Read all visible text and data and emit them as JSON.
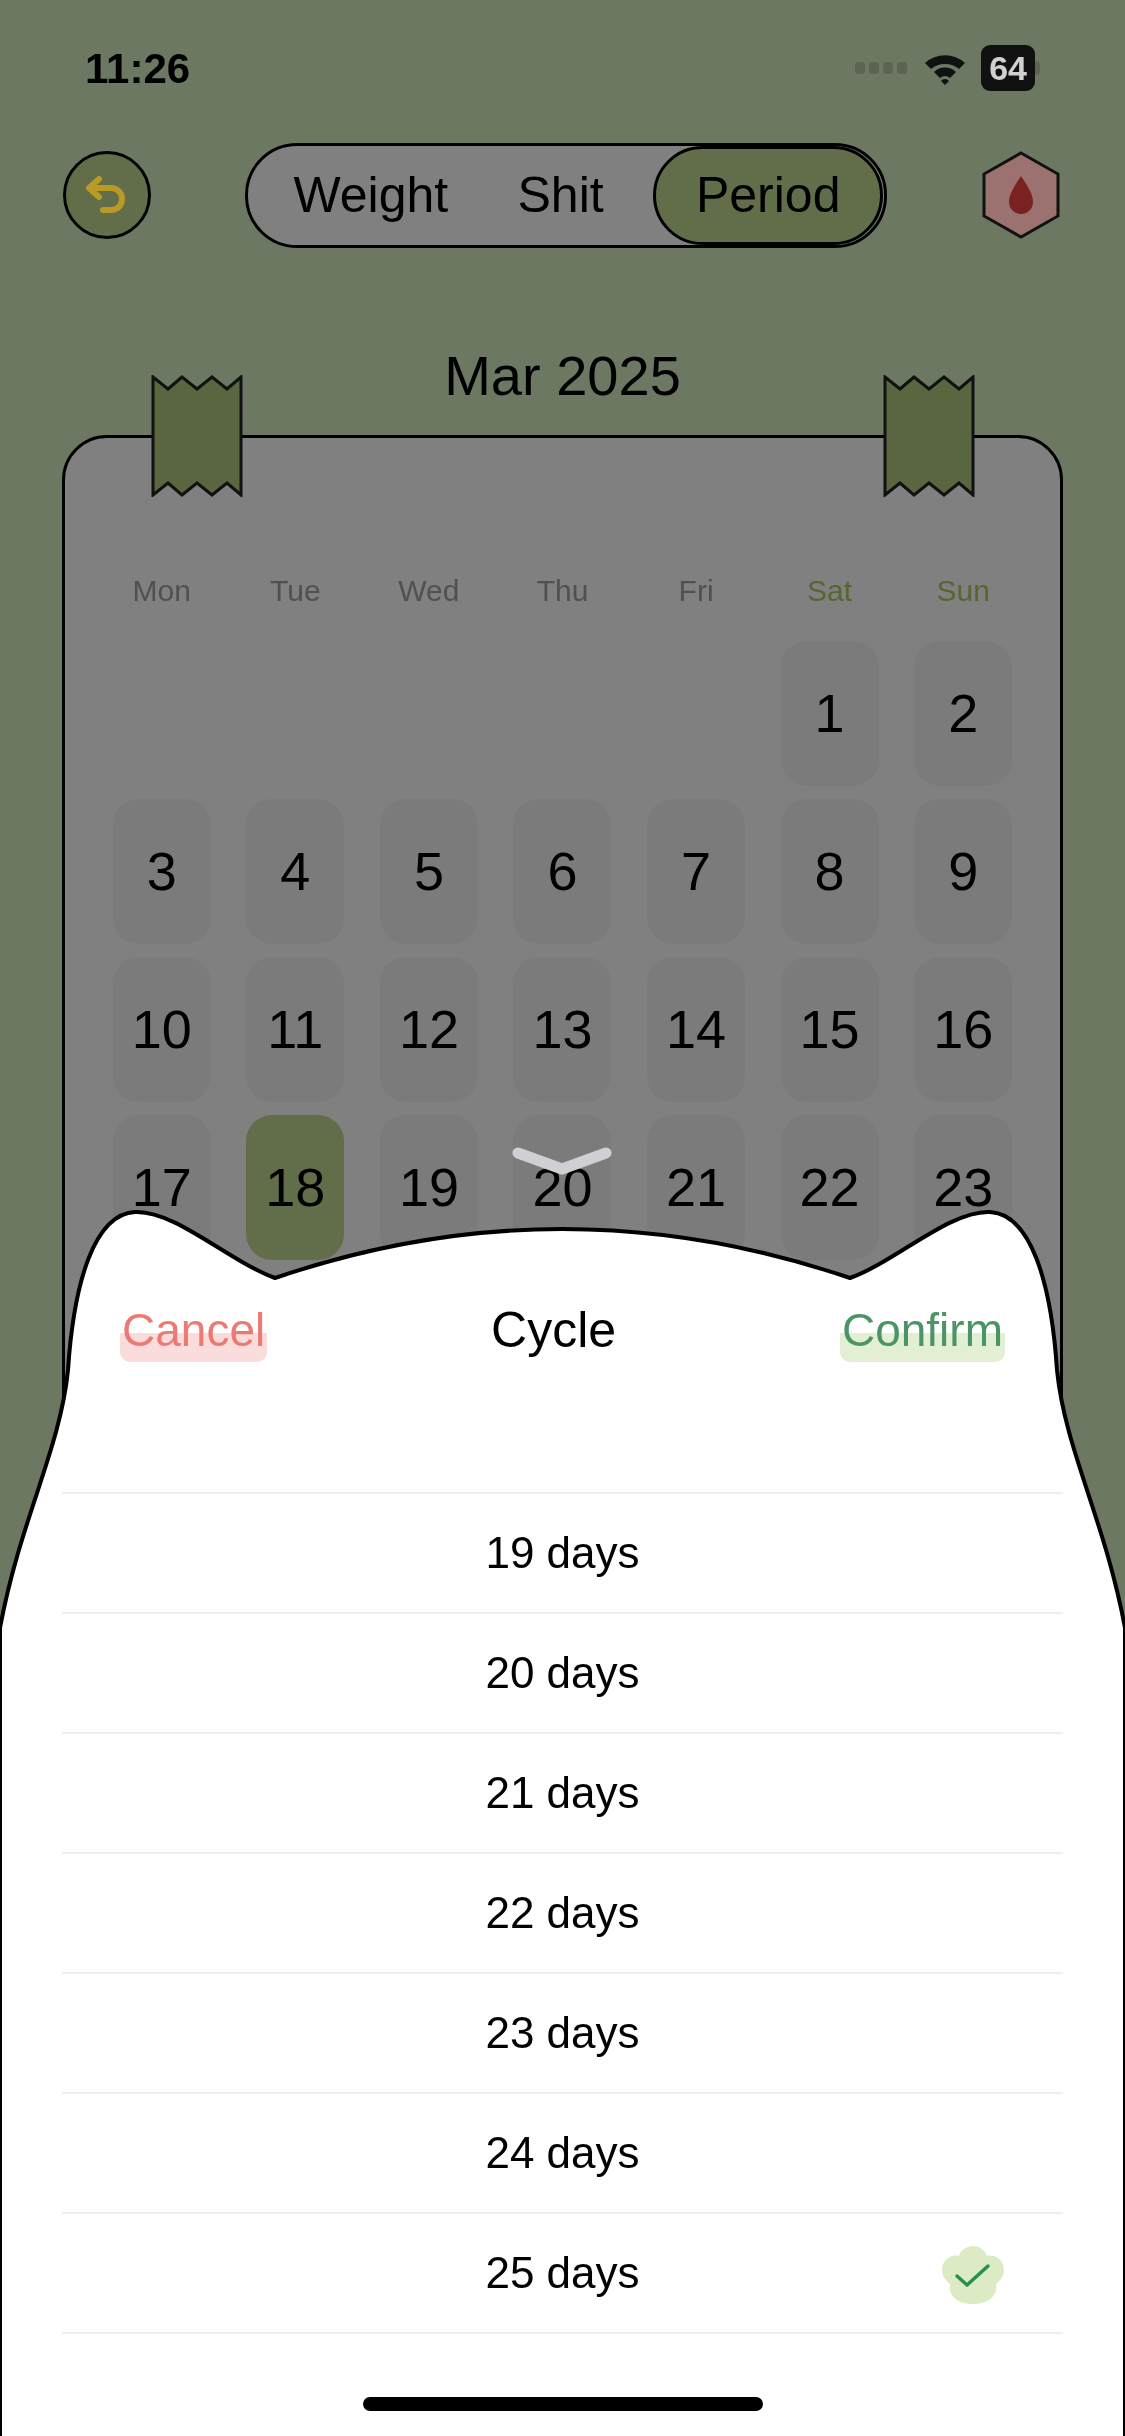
{
  "status_bar": {
    "time": "11:26",
    "battery": "64"
  },
  "tabs": [
    {
      "label": "Weight",
      "selected": false
    },
    {
      "label": "Shit",
      "selected": false
    },
    {
      "label": "Period",
      "selected": true
    }
  ],
  "calendar": {
    "month": "Mar 2025",
    "weekdays": [
      {
        "label": "Mon",
        "weekend": false
      },
      {
        "label": "Tue",
        "weekend": false
      },
      {
        "label": "Wed",
        "weekend": false
      },
      {
        "label": "Thu",
        "weekend": false
      },
      {
        "label": "Fri",
        "weekend": false
      },
      {
        "label": "Sat",
        "weekend": true
      },
      {
        "label": "Sun",
        "weekend": true
      }
    ],
    "weeks": [
      [
        {
          "kind": "blank"
        },
        {
          "kind": "blank"
        },
        {
          "kind": "blank"
        },
        {
          "kind": "blank"
        },
        {
          "kind": "blank"
        },
        {
          "kind": "day",
          "label": "1",
          "selected": false
        },
        {
          "kind": "day",
          "label": "2",
          "selected": false
        }
      ],
      [
        {
          "kind": "day",
          "label": "3",
          "selected": false
        },
        {
          "kind": "day",
          "label": "4",
          "selected": false
        },
        {
          "kind": "day",
          "label": "5",
          "selected": false
        },
        {
          "kind": "day",
          "label": "6",
          "selected": false
        },
        {
          "kind": "day",
          "label": "7",
          "selected": false
        },
        {
          "kind": "day",
          "label": "8",
          "selected": false
        },
        {
          "kind": "day",
          "label": "9",
          "selected": false
        }
      ],
      [
        {
          "kind": "day",
          "label": "10",
          "selected": false
        },
        {
          "kind": "day",
          "label": "11",
          "selected": false
        },
        {
          "kind": "day",
          "label": "12",
          "selected": false
        },
        {
          "kind": "day",
          "label": "13",
          "selected": false
        },
        {
          "kind": "day",
          "label": "14",
          "selected": false
        },
        {
          "kind": "day",
          "label": "15",
          "selected": false
        },
        {
          "kind": "day",
          "label": "16",
          "selected": false
        }
      ],
      [
        {
          "kind": "day",
          "label": "17",
          "selected": false
        },
        {
          "kind": "day",
          "label": "18",
          "selected": true
        },
        {
          "kind": "day",
          "label": "19",
          "selected": false
        },
        {
          "kind": "day",
          "label": "20",
          "selected": false
        },
        {
          "kind": "day",
          "label": "21",
          "selected": false
        },
        {
          "kind": "day",
          "label": "22",
          "selected": false
        },
        {
          "kind": "day",
          "label": "23",
          "selected": false
        }
      ]
    ]
  },
  "sheet": {
    "cancel": "Cancel",
    "title": "Cycle",
    "confirm": "Confirm",
    "options": [
      {
        "label": "19 days",
        "selected": false
      },
      {
        "label": "20 days",
        "selected": false
      },
      {
        "label": "21 days",
        "selected": false
      },
      {
        "label": "22 days",
        "selected": false
      },
      {
        "label": "23 days",
        "selected": false
      },
      {
        "label": "24 days",
        "selected": false
      },
      {
        "label": "25 days",
        "selected": true
      }
    ]
  }
}
